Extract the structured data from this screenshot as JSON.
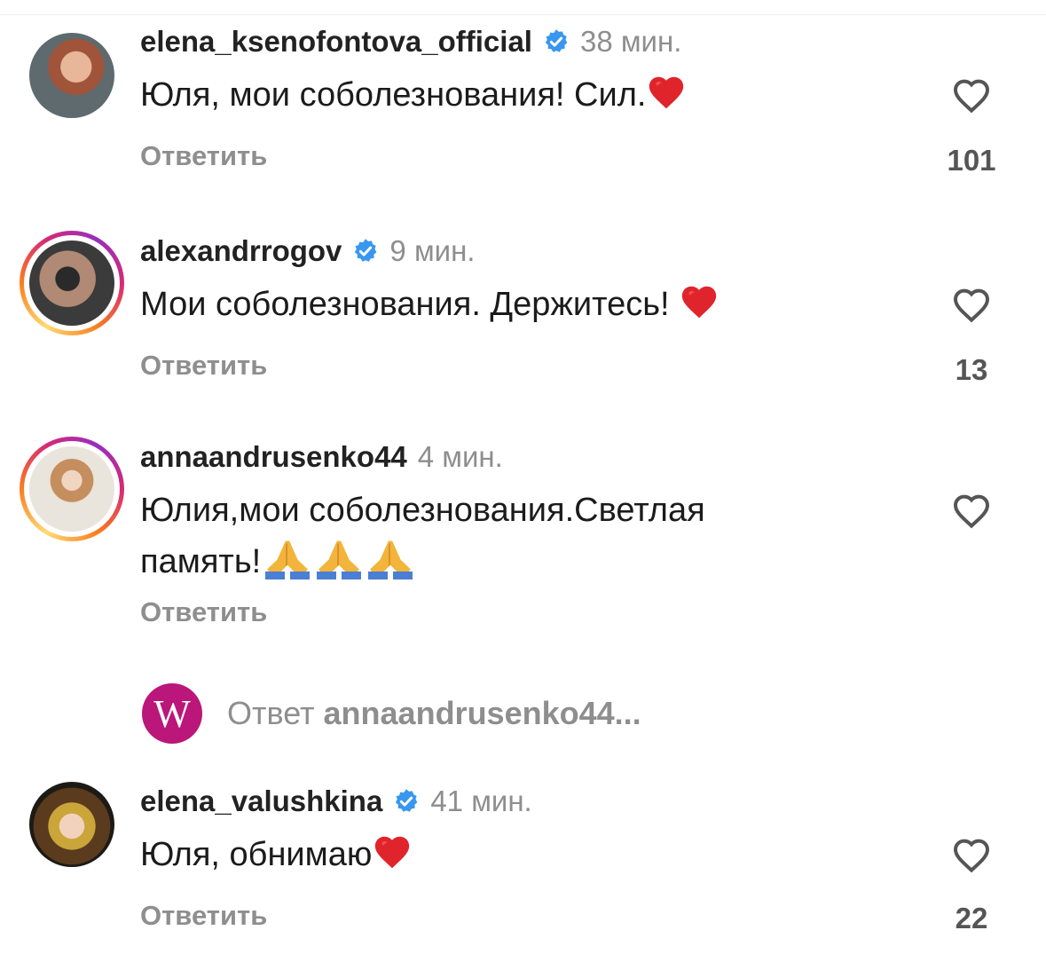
{
  "comments": [
    {
      "username": "elena_ksenofontova_official",
      "verified": true,
      "time": "38 мин.",
      "text": "Юля, мои соболезнования! Сил.",
      "emoji": "red-heart",
      "reply_label": "Ответить",
      "likes": "101"
    },
    {
      "username": "alexandrrogov",
      "verified": true,
      "time": "9 мин.",
      "text": "Мои соболезнования. Держитесь! ",
      "emoji": "red-heart",
      "reply_label": "Ответить",
      "likes": "13"
    },
    {
      "username": "annaandrusenko44",
      "verified": false,
      "time": "4 мин.",
      "text_line1": "Юлия,мои соболезнования.Светлая",
      "text_line2": "память!",
      "emoji": "folded-hands x3",
      "reply_label": "Ответить",
      "likes": ""
    },
    {
      "username": "elena_valushkina",
      "verified": true,
      "time": "41 мин.",
      "text": "Юля, обнимаю",
      "emoji": "red-heart",
      "reply_label": "Ответить",
      "likes": "22"
    }
  ],
  "reply_thread": {
    "avatar_letter": "W",
    "prefix": "Ответ",
    "user": "annaandrusenko44..."
  },
  "colors": {
    "verified": "#3897f0",
    "muted": "#8e8e8e",
    "w_logo": "#bb1679"
  }
}
